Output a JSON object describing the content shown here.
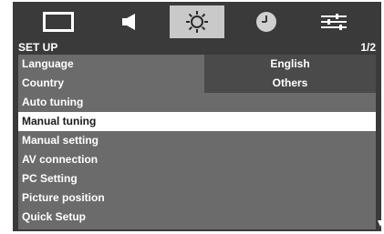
{
  "tabs": [
    {
      "name": "picture",
      "icon": "picture-icon"
    },
    {
      "name": "sound",
      "icon": "speaker-icon"
    },
    {
      "name": "setup",
      "icon": "gear-icon",
      "active": true
    },
    {
      "name": "timer",
      "icon": "clock-icon"
    },
    {
      "name": "options",
      "icon": "sliders-icon"
    }
  ],
  "header": {
    "title": "SET UP",
    "page": "1/2"
  },
  "menu": {
    "items": [
      {
        "label": "Language"
      },
      {
        "label": "Country"
      },
      {
        "label": "Auto tuning"
      },
      {
        "label": "Manual tuning",
        "selected": true
      },
      {
        "label": "Manual setting"
      },
      {
        "label": "AV connection"
      },
      {
        "label": "PC Setting"
      },
      {
        "label": "Picture position"
      },
      {
        "label": "Quick Setup"
      }
    ],
    "values": [
      "English",
      "Others"
    ]
  },
  "colors": {
    "background": "#3a3a3a",
    "menu": "#6b6b6b",
    "submenu": "#4a4a4a",
    "highlight": "#ffffff",
    "active_tab": "#c9c9c9"
  }
}
